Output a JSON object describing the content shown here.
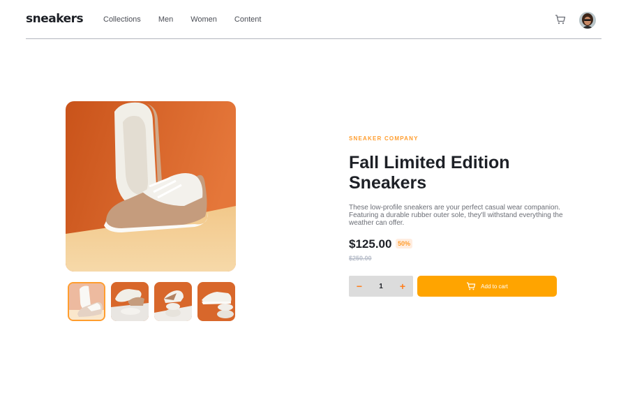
{
  "header": {
    "logo": "sneakers",
    "nav": [
      "Collections",
      "Men",
      "Women",
      "Content"
    ]
  },
  "product": {
    "company": "SNEAKER COMPANY",
    "title": "Fall Limited Edition Sneakers",
    "description": "These low-profile sneakers are your perfect casual wear companion. Featuring a durable rubber outer sole, they'll withstand everything the weather can offer.",
    "price": "$125.00",
    "discount": "50%",
    "original_price": "$250.00"
  },
  "cart": {
    "quantity": "1",
    "minus": "−",
    "plus": "+",
    "add_label": "Add to cart"
  },
  "colors": {
    "accent": "#ffa400",
    "accent_text": "#ff9d2e",
    "accent_soft": "#ffede0",
    "dark": "#1d2026",
    "muted": "#6b6e76"
  }
}
